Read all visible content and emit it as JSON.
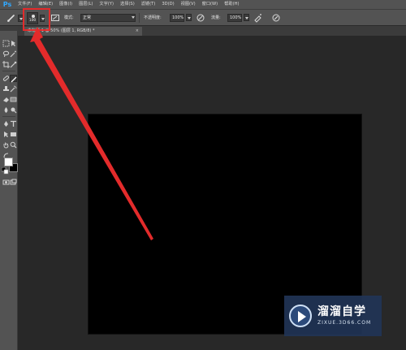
{
  "app": {
    "logo": "Ps"
  },
  "menu": [
    "文件(F)",
    "编辑(E)",
    "图像(I)",
    "图层(L)",
    "文字(Y)",
    "选择(S)",
    "滤镜(T)",
    "3D(D)",
    "视图(V)",
    "窗口(W)",
    "帮助(H)"
  ],
  "options": {
    "brush_size": "100",
    "mode_label": "模式:",
    "mode_value": "正常",
    "opacity_label": "不透明度:",
    "opacity_value": "100%",
    "flow_label": "流量:",
    "flow_value": "100%"
  },
  "document": {
    "tab_title": "未标题-1 @ 50% (图层 1, RGB/8) *",
    "close": "×"
  },
  "watermark": {
    "title": "溜溜自学",
    "url": "ZIXUE.3D66.COM"
  },
  "colors": {
    "annotation": "#e32b2b",
    "canvas": "#000000",
    "foreground": "#ffffff",
    "background": "#000000"
  }
}
